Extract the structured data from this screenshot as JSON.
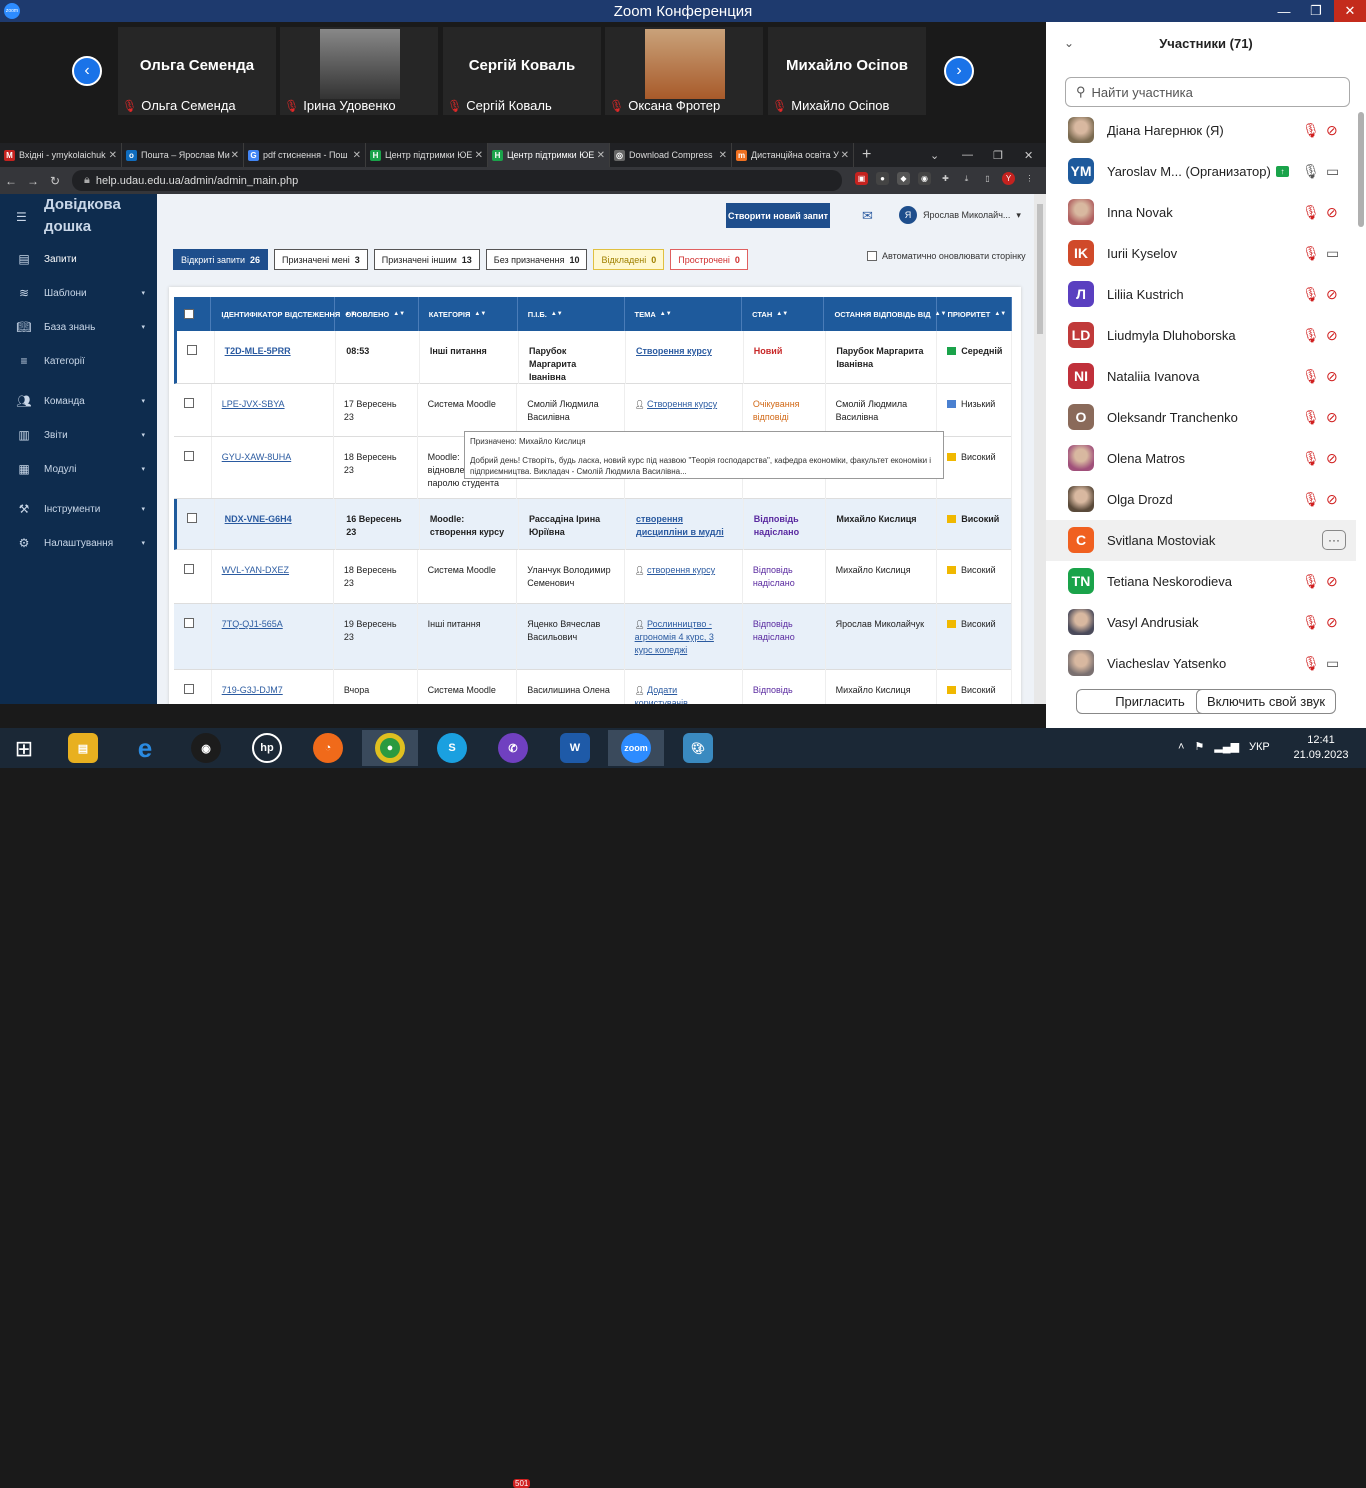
{
  "zoom": {
    "title": "Zoom Конференция",
    "logo_text": "zoom",
    "gallery": [
      {
        "name_big": "Ольга Семенда",
        "label": "Ольга Семенда",
        "photo": false
      },
      {
        "name_big": "",
        "label": "Ірина Удовенко",
        "photo": true
      },
      {
        "name_big": "Сергій Коваль",
        "label": "Сергій Коваль",
        "photo": false
      },
      {
        "name_big": "",
        "label": "Оксана Фротер",
        "photo": true
      },
      {
        "name_big": "Михайло Осіпов",
        "label": "Михайло Осіпов",
        "photo": false
      }
    ]
  },
  "browser": {
    "tabs": [
      {
        "label": "Вхідні - ymykolaichuk",
        "fav": "M",
        "color": "#c5221f"
      },
      {
        "label": "Пошта – Ярослав Ми",
        "fav": "o",
        "color": "#0f6cbd"
      },
      {
        "label": "pdf стиснення - Пош",
        "fav": "G",
        "color": "#4285f4"
      },
      {
        "label": "Центр підтримки ЮЕ",
        "fav": "H",
        "color": "#1aa34a"
      },
      {
        "label": "Центр підтримки ЮЕ",
        "fav": "H",
        "color": "#1aa34a"
      },
      {
        "label": "Download Compress",
        "fav": "◎",
        "color": "#666"
      },
      {
        "label": "Дистанційна освіта У",
        "fav": "m",
        "color": "#f07020"
      }
    ],
    "url": "help.udau.edu.ua/admin/admin_main.php"
  },
  "app": {
    "logo_line1": "Довідкова",
    "logo_line2": "дошка",
    "menu": [
      {
        "label": "Запити",
        "arrow": ""
      },
      {
        "label": "Шаблони",
        "arrow": "▾"
      },
      {
        "label": "База знань",
        "arrow": "▾"
      },
      {
        "label": "Категорії",
        "arrow": ""
      },
      {
        "label": "Команда",
        "arrow": "▾"
      },
      {
        "label": "Звіти",
        "arrow": "▾"
      },
      {
        "label": "Модулі",
        "arrow": "▾"
      },
      {
        "label": "Інструменти",
        "arrow": "▾"
      },
      {
        "label": "Налаштування",
        "arrow": "▾"
      }
    ],
    "new_ticket": "Створити новий запит",
    "user_initial": "Я",
    "user_name": "Ярослав Миколайч...",
    "filters": [
      {
        "label": "Відкриті запити",
        "count": "26"
      },
      {
        "label": "Призначені мені",
        "count": "3"
      },
      {
        "label": "Призначені іншим",
        "count": "13"
      },
      {
        "label": "Без призначення",
        "count": "10"
      },
      {
        "label": "Відкладені",
        "count": "0"
      },
      {
        "label": "Прострочені",
        "count": "0"
      }
    ],
    "auto_refresh": "Автоматично оновлювати сторінку",
    "columns": [
      "ІДЕНТИФІКАТОР ВІДСТЕЖЕННЯ",
      "ОНОВЛЕНО",
      "КАТЕГОРІЯ",
      "П.І.Б.",
      "ТЕМА",
      "СТАН",
      "ОСТАННЯ ВІДПОВІДЬ ВІД",
      "ПРІОРИТЕТ"
    ],
    "rows": [
      {
        "id": "T2D-MLE-5PRR",
        "updated": "08:53",
        "category": "Інші питання",
        "name": "Парубок Маргарита Іванівна",
        "subject": "Створення курсу",
        "status": "Новий",
        "last": "Парубок Маргарита Іванівна",
        "priority": "Середній",
        "pcolor": "#1aa34a",
        "scolor": "red",
        "bold": true,
        "hl": false
      },
      {
        "id": "LPE-JVX-SBYA",
        "updated": "17 Вересень 23",
        "category": "Система Moodle",
        "name": "Смолій Людмила Василівна",
        "subject": "Створення курсу",
        "status": "Очікування відповіді",
        "last": "Смолій Людмила Василівна",
        "priority": "Низький",
        "pcolor": "#4a80d0",
        "scolor": "org",
        "bold": false,
        "hl": false
      },
      {
        "id": "GYU-XAW-8UHA",
        "updated": "18 Вересень 23",
        "category": "Moodle: відновлення паролю студента",
        "name": "",
        "subject": "",
        "status": "",
        "last": "",
        "priority": "Високий",
        "pcolor": "#f0b800",
        "scolor": "",
        "bold": false,
        "hl": false
      },
      {
        "id": "NDX-VNE-G6H4",
        "updated": "16 Вересень 23",
        "category": "Moodle: створення курсу",
        "name": "Рассадіна Ірина Юріївна",
        "subject": "створення дисципліни в мудлі",
        "status": "Відповідь надіслано",
        "last": "Михайло Кислиця",
        "priority": "Високий",
        "pcolor": "#f0b800",
        "scolor": "pur",
        "bold": true,
        "hl": true
      },
      {
        "id": "WVL-YAN-DXEZ",
        "updated": "18 Вересень 23",
        "category": "Система Moodle",
        "name": "Уланчук Володимир Семенович",
        "subject": "створення курсу",
        "status": "Відповідь надіслано",
        "last": "Михайло Кислиця",
        "priority": "Високий",
        "pcolor": "#f0b800",
        "scolor": "pur",
        "bold": false,
        "hl": false
      },
      {
        "id": "7TQ-QJ1-565A",
        "updated": "19 Вересень 23",
        "category": "Інші питання",
        "name": "Яценко Вячеслав Васильович",
        "subject": "Рослинництво - агрономія 4 курс, 3 курс коледжі",
        "status": "Відповідь надіслано",
        "last": "Ярослав Миколайчук",
        "priority": "Високий",
        "pcolor": "#f0b800",
        "scolor": "pur",
        "bold": false,
        "hl": true
      },
      {
        "id": "719-G3J-DJM7",
        "updated": "Вчора",
        "category": "Система Moodle",
        "name": "Василишина Олена",
        "subject": "Додати користувачів",
        "status": "Відповідь",
        "last": "Михайло Кислиця",
        "priority": "Високий",
        "pcolor": "#f0b800",
        "scolor": "pur",
        "bold": false,
        "hl": false
      }
    ],
    "tooltip_line1": "Призначено: Михайло Кислиця",
    "tooltip_line2": "Добрий день! Створіть, будь ласка, новий курс під назвою \"Теорія господарства\", кафедра економіки, факультет економіки і підприємництва. Викладач - Смолій Людмила Василівна..."
  },
  "participants": {
    "title": "Участники (71)",
    "search_placeholder": "Найти участника",
    "list": [
      {
        "name": "Діана Нагернюк (Я)",
        "initials": "",
        "color": "#7a6a50",
        "photo": true,
        "mic": "off",
        "cam": "off"
      },
      {
        "name": "Yaroslav M... (Организатор)",
        "initials": "YM",
        "color": "#1e5a9c",
        "photo": false,
        "mic": "on",
        "cam": "on"
      },
      {
        "name": "Inna Novak",
        "initials": "",
        "color": "#b06060",
        "photo": true,
        "mic": "off",
        "cam": "off"
      },
      {
        "name": "Iurii Kyselov",
        "initials": "IK",
        "color": "#d04a2a",
        "photo": false,
        "mic": "off",
        "cam": "on"
      },
      {
        "name": "Liliia Kustrich",
        "initials": "Л",
        "color": "#5a3fc0",
        "photo": false,
        "mic": "off",
        "cam": "off"
      },
      {
        "name": "Liudmyla Dluhoborska",
        "initials": "LD",
        "color": "#c03a3a",
        "photo": false,
        "mic": "off",
        "cam": "off"
      },
      {
        "name": "Nataliia Ivanova",
        "initials": "NI",
        "color": "#c0303a",
        "photo": false,
        "mic": "off",
        "cam": "off"
      },
      {
        "name": "Oleksandr Tranchenko",
        "initials": "O",
        "color": "#8a6a5a",
        "photo": false,
        "mic": "off",
        "cam": "off"
      },
      {
        "name": "Olena Matros",
        "initials": "",
        "color": "#a0507a",
        "photo": true,
        "mic": "off",
        "cam": "off"
      },
      {
        "name": "Olga Drozd",
        "initials": "",
        "color": "#5a4a3a",
        "photo": true,
        "mic": "off",
        "cam": "off"
      },
      {
        "name": "Svitlana Mostoviak",
        "initials": "C",
        "color": "#f06020",
        "photo": false,
        "mic": "none",
        "cam": "none"
      },
      {
        "name": "Tetiana Neskorodieva",
        "initials": "TN",
        "color": "#1aa34a",
        "photo": false,
        "mic": "off",
        "cam": "off"
      },
      {
        "name": "Vasyl Andrusiak",
        "initials": "",
        "color": "#4a4a5a",
        "photo": true,
        "mic": "off",
        "cam": "off"
      },
      {
        "name": "Viacheslav Yatsenko",
        "initials": "",
        "color": "#7a7070",
        "photo": true,
        "mic": "off",
        "cam": "on"
      }
    ],
    "invite": "Пригласить",
    "unmute": "Включить свой звук",
    "more": "···"
  },
  "taskbar": {
    "lang": "УКР",
    "time": "12:41",
    "date": "21.09.2023",
    "viber_badge": "501",
    "zoom_label": "zoom",
    "hp_label": "hp",
    "word_label": "W",
    "skype_label": "S"
  }
}
